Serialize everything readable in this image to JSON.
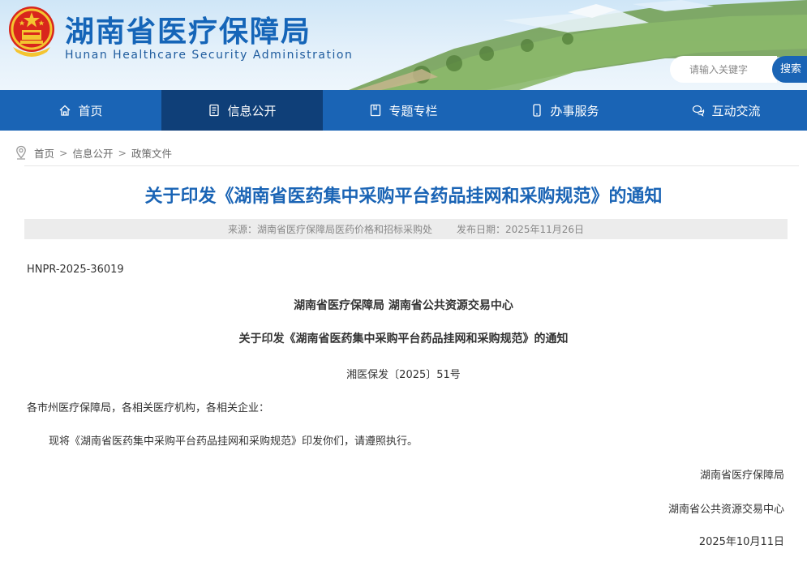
{
  "header": {
    "title": "湖南省医疗保障局",
    "subtitle": "Hunan Healthcare Security Administration",
    "search": {
      "placeholder": "请输入关键字",
      "button_label": "搜索"
    }
  },
  "nav": {
    "items": [
      {
        "label": "首页",
        "icon": "home-icon"
      },
      {
        "label": "信息公开",
        "icon": "document-icon",
        "active": true
      },
      {
        "label": "专题专栏",
        "icon": "book-icon"
      },
      {
        "label": "办事服务",
        "icon": "phone-icon"
      },
      {
        "label": "互动交流",
        "icon": "chat-icon"
      }
    ]
  },
  "breadcrumb": {
    "items": [
      "首页",
      "信息公开",
      "政策文件"
    ],
    "separator": ">"
  },
  "article": {
    "title": "关于印发《湖南省医药集中采购平台药品挂网和采购规范》的通知",
    "source": "来源：湖南省医疗保障局医药价格和招标采购处",
    "publish_date": "发布日期：2025年11月26日",
    "doc_number": "HNPR-2025-36019",
    "issuers": "湖南省医疗保障局 湖南省公共资源交易中心",
    "subtitle": "关于印发《湖南省医药集中采购平台药品挂网和采购规范》的通知",
    "file_number": "湘医保发〔2025〕51号",
    "recipients": "各市州医疗保障局，各相关医疗机构，各相关企业：",
    "body": "现将《湖南省医药集中采购平台药品挂网和采购规范》印发你们，请遵照执行。",
    "signatures": [
      "湖南省医疗保障局",
      "湖南省公共资源交易中心"
    ],
    "sign_date": "2025年10月11日"
  },
  "colors": {
    "brand_blue": "#1a64b5",
    "nav_active": "#0f3f78",
    "title_blue": "#1a64b5",
    "meta_bg": "#ececec"
  }
}
